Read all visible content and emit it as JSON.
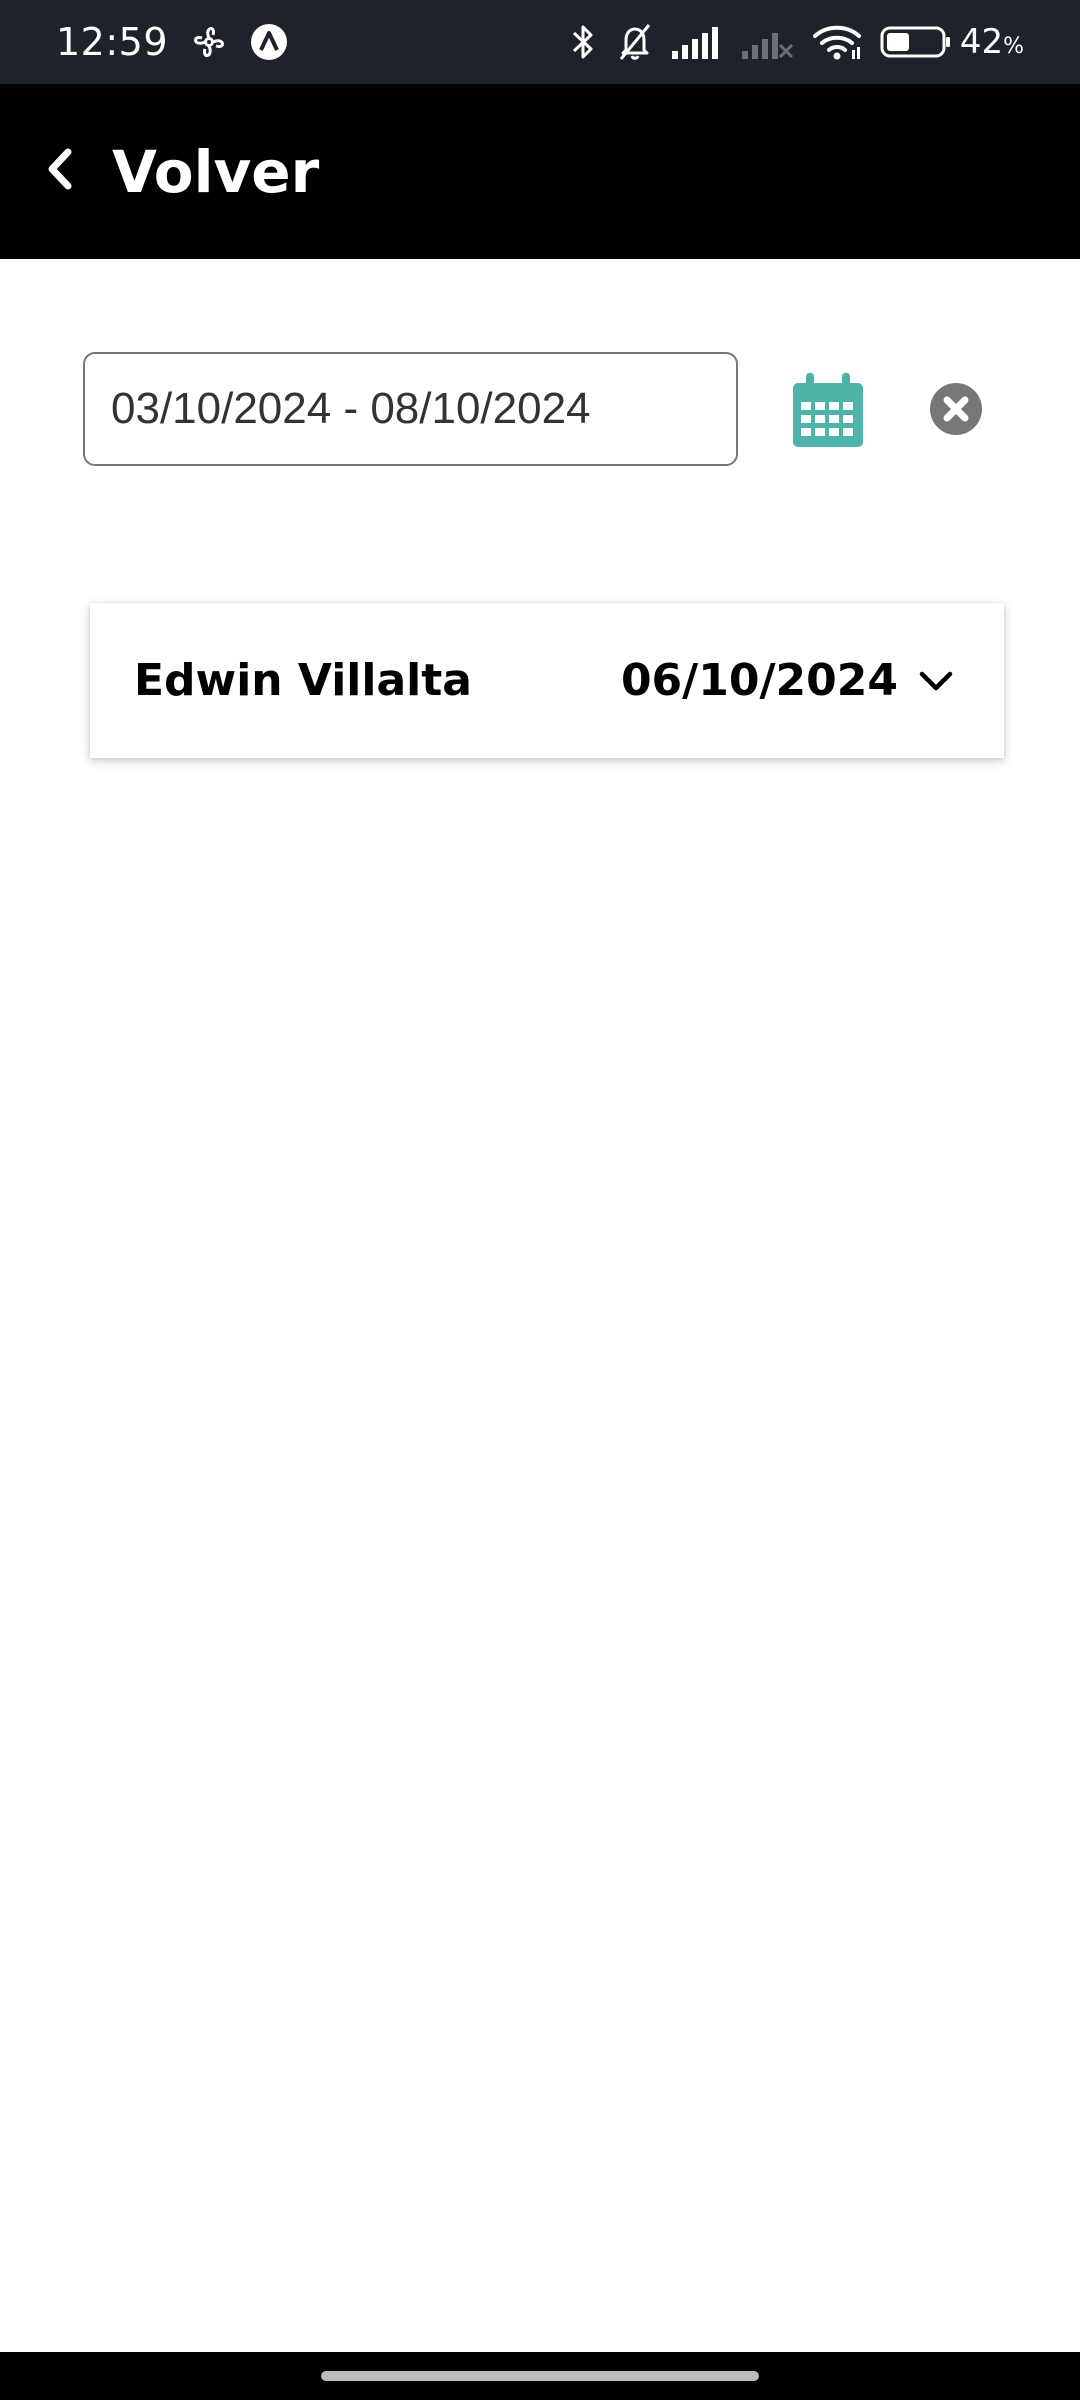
{
  "status_bar": {
    "time": "12:59",
    "battery_percent": "42",
    "battery_unit": "%",
    "battery_level": 0.42,
    "icons": [
      "fan-icon",
      "a-badge-icon",
      "bluetooth-icon",
      "bell-off-icon",
      "signal-icon",
      "signal-no-service-icon",
      "wifi-icon",
      "battery-icon"
    ]
  },
  "header": {
    "back_label": "Volver",
    "back_icon": "chevron-left-icon"
  },
  "filters": {
    "date_range_value": "03/10/2024 - 08/10/2024",
    "calendar_icon": "calendar-icon",
    "calendar_color": "#4fb3a9",
    "clear_icon": "clear-circle-icon",
    "clear_color": "#777777"
  },
  "records": [
    {
      "name": "Edwin Villalta",
      "date": "06/10/2024",
      "expand_icon": "chevron-down-icon"
    }
  ]
}
